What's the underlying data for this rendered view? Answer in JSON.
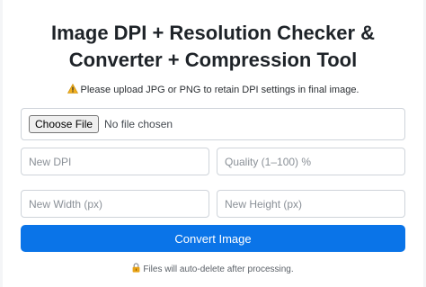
{
  "header": {
    "title_line1": "Image DPI + Resolution Checker &",
    "title_line2": "Converter + Compression Tool"
  },
  "notice": {
    "icon": "warning-icon",
    "text": "Please upload JPG or PNG to retain DPI settings in final image."
  },
  "file_input": {
    "button_label": "Choose File",
    "status": "No file chosen"
  },
  "fields": {
    "dpi_placeholder": "New DPI",
    "quality_placeholder": "Quality (1–100) %",
    "width_placeholder": "New Width (px)",
    "height_placeholder": "New Height (px)"
  },
  "actions": {
    "convert_label": "Convert Image"
  },
  "footnote": {
    "icon": "lock-icon",
    "text": "Files will auto-delete after processing."
  },
  "colors": {
    "primary": "#0a74e8",
    "warning": "#f2b01e",
    "lock": "#e8a317"
  }
}
